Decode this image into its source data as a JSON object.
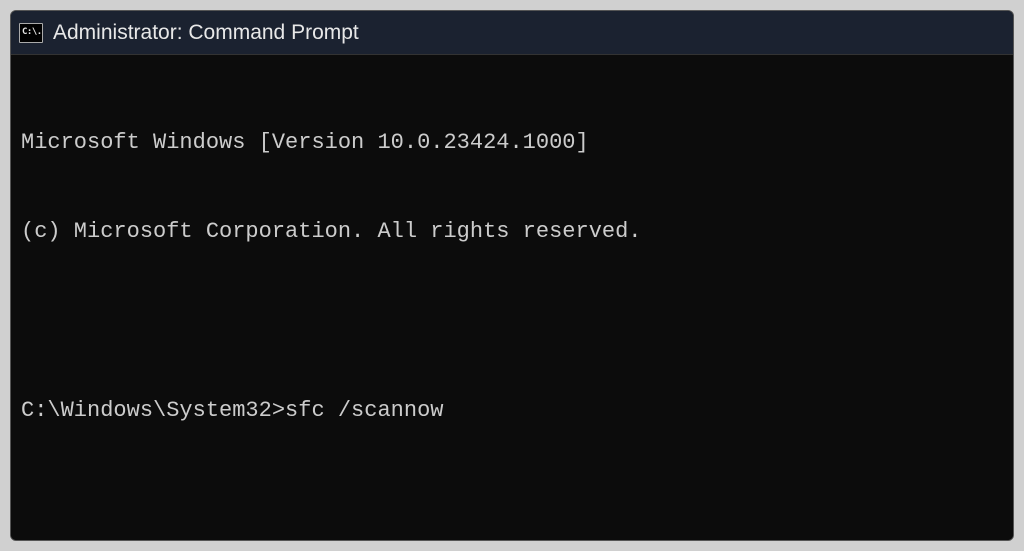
{
  "titlebar": {
    "icon_text": "C:\\.",
    "title": "Administrator: Command Prompt"
  },
  "console": {
    "line1": "Microsoft Windows [Version 10.0.23424.1000]",
    "line2": "(c) Microsoft Corporation. All rights reserved.",
    "prompt": "C:\\Windows\\System32>",
    "command": "sfc /scannow"
  }
}
